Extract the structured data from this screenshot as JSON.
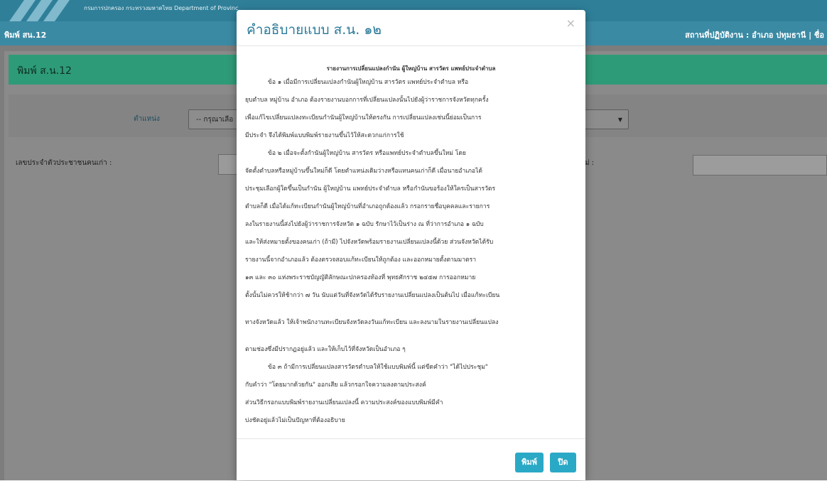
{
  "header": {
    "department": "กรมการปกครอง กระทรวงมหาดไทย Department of Provinc",
    "breadcrumb": "พิมพ์ สน.12",
    "workplace": "สถานที่ปฏิบัติงาน : อำเภอ ปทุมธานี | ชื่อ"
  },
  "page": {
    "title": "พิมพ์ ส.น.12",
    "position_label": "ตำแหน่ง",
    "position_select_value": "-- กรุณาเลือ",
    "old_id_label": "เลขประจำตัวประชาชนคนเก่า :",
    "new_label": "ม่ :"
  },
  "modal": {
    "title": "คำอธิบายแบบ ส.น. ๑๒",
    "close_icon": "×",
    "heading": "รายงานการเปลี่ยนแปลงกำนัน ผู้ใหญ่บ้าน สารวัตร แพทย์ประจำตำบล",
    "paragraphs": [
      "ข้อ ๑ เมื่อมีการเปลี่ยนแปลงกำนันผู้ใหญ่บ้าน สารวัตร แพทย์ประจำตำบล หรือ",
      "ยุบตำบล หมู่บ้าน อำเภอ ต้องรายงานบอกการที่เปลี่ยนแปลงนั้นไปยังผู้ว่าราชการจังหวัดทุกครั้ง",
      "เพื่อแก้ไขเปลี่ยนแปลงทะเบียนกำนันผู้ใหญ่บ้านให้ตรงกัน การเปลี่ยนแปลงเช่นนี้ย่อมเป็นการ",
      "มีประจำ จึงได้พิมพ์แบบพิมพ์รายงานขึ้นไว้ให้สะดวกแก่การใช้",
      "ข้อ ๒ เมื่อจะตั้งกำนันผู้ใหญ่บ้าน สารวัตร หรือแพทย์ประจำตำบลขึ้นใหม่ โดย",
      "จัดตั้งตำบลหรือหมู่บ้านขึ้นใหม่ก็ดี โดยตำแหน่งเดิมว่างหรือแทนคนเก่าก็ดี เมื่อนายอำเภอได้",
      "ประชุมเลือกผู้ใดขึ้นเป็นกำนัน ผู้ใหญ่บ้าน แพทย์ประจำตำบล หรือกำนันขอร้องให้ใครเป็นสารวัตร",
      "ตำบลก็ดี เมื่อได้แก้ทะเบียนกำนันผู้ใหญ่บ้านที่อำเภอถูกต้องแล้ว กรอกรายชื่อบุคคลและรายการ",
      "ลงในรายงานนี้ส่งไปยังผู้ว่าราชการจังหวัด ๑ ฉบับ รักษาไว้เป็นร่าง ณ ที่ว่าการอำเภอ ๑ ฉบับ",
      "และให้ส่งหมายตั้งของคนเก่า (ถ้ามี) ไปจังหวัดพร้อมรายงานเปลี่ยนแปลงนี้ด้วย ส่วนจังหวัดได้รับ",
      "รายงานนี้จากอำเภอแล้ว ต้องตรวจสอบแก้ทะเบียนให้ถูกต้อง และออกหมายตั้งตามมาตรา",
      "๑๓ และ ๓๐ แห่งพระราชบัญญัติลักษณะปกครองท้องที่ พุทธศักราช ๒๔๕๗ การออกหมาย",
      "ตั้งนั้นไม่ควรให้ช้ากว่า ๗ วัน นับแต่วันที่จังหวัดได้รับรายงานเปลี่ยนแปลงเป็นต้นไป เมื่อแก้ทะเบียน",
      "ทางจังหวัดแล้ว ให้เจ้าพนักงานทะเบียนจังหวัดลงวันแก้ทะเบียน และลงนามในรายงานเปลี่ยนแปลง",
      "ตามช่องซึ่งมีปรากฏอยู่แล้ว และให้เก็บไว้ที่จังหวัดเป็นอำเภอ ๆ",
      "ข้อ ๓ ถ้ามีการเปลี่ยนแปลงสารวัตรตำบลให้ใช้แบบพิมพ์นี้ แต่ขีดคำว่า \"ได้ไปประชุม\"",
      "กับคำว่า \"โดยมากด้วยกัน\" ออกเสีย แล้วกรอกใจความลงตามประสงค์",
      "ส่วนวิธีกรอกแบบพิมพ์รายงานเปลี่ยนแปลงนี้ ความประสงค์ของแบบพิมพ์มีคำ",
      "บ่งชัดอยู่แล้วไม่เป็นปัญหาที่ต้องอธิบาย"
    ],
    "print_button": "พิมพ์",
    "close_button": "ปิด"
  }
}
